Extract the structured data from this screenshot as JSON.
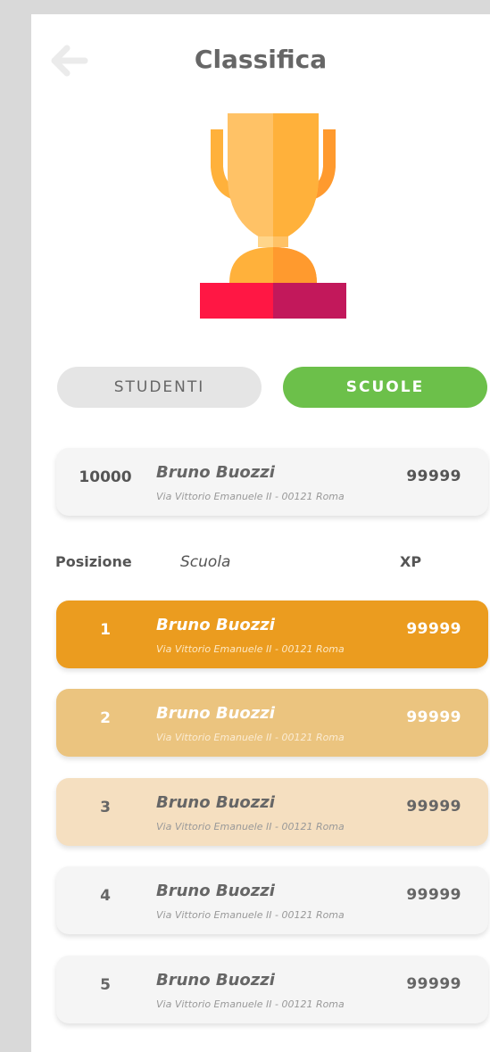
{
  "header": {
    "title": "Classifica"
  },
  "tabs": {
    "students": "STUDENTI",
    "schools": "SCUOLE"
  },
  "my_rank": {
    "position": "10000",
    "name": "Bruno Buozzi",
    "address": "Via Vittorio Emanuele II - 00121 Roma",
    "xp": "99999"
  },
  "columns": {
    "position": "Posizione",
    "school": "Scuola",
    "xp": "XP"
  },
  "rows": [
    {
      "position": "1",
      "name": "Bruno Buozzi",
      "address": "Via Vittorio Emanuele II - 00121 Roma",
      "xp": "99999"
    },
    {
      "position": "2",
      "name": "Bruno Buozzi",
      "address": "Via Vittorio Emanuele II - 00121 Roma",
      "xp": "99999"
    },
    {
      "position": "3",
      "name": "Bruno Buozzi",
      "address": "Via Vittorio Emanuele II - 00121 Roma",
      "xp": "99999"
    },
    {
      "position": "4",
      "name": "Bruno Buozzi",
      "address": "Via Vittorio Emanuele II - 00121 Roma",
      "xp": "99999"
    },
    {
      "position": "5",
      "name": "Bruno Buozzi",
      "address": "Via Vittorio Emanuele II - 00121 Roma",
      "xp": "99999"
    }
  ],
  "colors": {
    "accent_green": "#6cc04a",
    "rank1": "#eb9c1f",
    "rank2": "#ebc47f",
    "rank3": "#f5dfc0",
    "default_row": "#f5f5f5",
    "trophy_cup": "#ffc266",
    "trophy_base": "#ff1744"
  },
  "icons": {
    "back": "arrow-left-icon",
    "trophy": "trophy-icon"
  }
}
